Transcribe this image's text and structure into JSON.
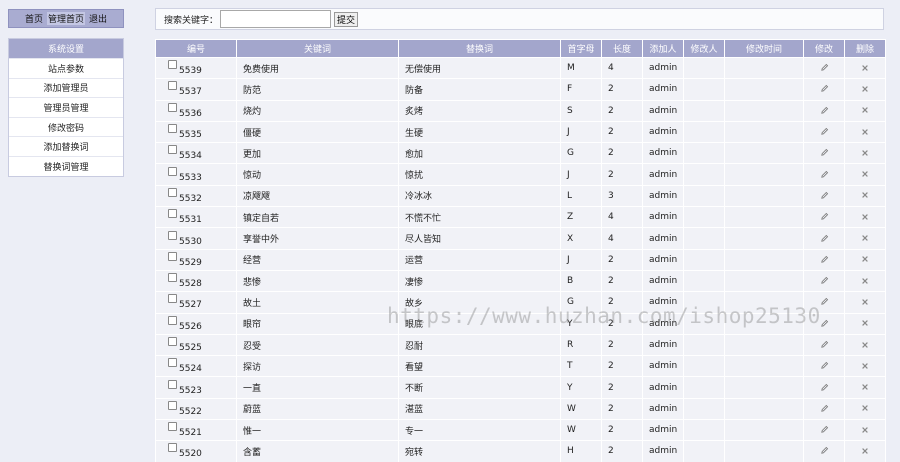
{
  "topnav": {
    "items": [
      "首页",
      "管理首页",
      "退出"
    ]
  },
  "sidemenu": {
    "title": "系统设置",
    "items": [
      "站点参数",
      "添加管理员",
      "管理员管理",
      "修改密码",
      "添加替换词",
      "替换词管理"
    ]
  },
  "search": {
    "label": "搜索关键字：",
    "value": "",
    "placeholder": "",
    "button": "提交"
  },
  "table": {
    "headers": [
      "编号",
      "关键词",
      "替换词",
      "首字母",
      "长度",
      "添加人",
      "修改人",
      "修改时间",
      "修改",
      "删除"
    ],
    "rows": [
      {
        "id": "5539",
        "keyword": "免费使用",
        "replace": "无偿使用",
        "initial": "M",
        "length": "4",
        "adder": "admin",
        "modifier": "",
        "modtime": ""
      },
      {
        "id": "5537",
        "keyword": "防范",
        "replace": "防备",
        "initial": "F",
        "length": "2",
        "adder": "admin",
        "modifier": "",
        "modtime": ""
      },
      {
        "id": "5536",
        "keyword": "烧灼",
        "replace": "炙烤",
        "initial": "S",
        "length": "2",
        "adder": "admin",
        "modifier": "",
        "modtime": ""
      },
      {
        "id": "5535",
        "keyword": "僵硬",
        "replace": "生硬",
        "initial": "J",
        "length": "2",
        "adder": "admin",
        "modifier": "",
        "modtime": ""
      },
      {
        "id": "5534",
        "keyword": "更加",
        "replace": "愈加",
        "initial": "G",
        "length": "2",
        "adder": "admin",
        "modifier": "",
        "modtime": ""
      },
      {
        "id": "5533",
        "keyword": "惊动",
        "replace": "惊扰",
        "initial": "J",
        "length": "2",
        "adder": "admin",
        "modifier": "",
        "modtime": ""
      },
      {
        "id": "5532",
        "keyword": "凉飕飕",
        "replace": "冷冰冰",
        "initial": "L",
        "length": "3",
        "adder": "admin",
        "modifier": "",
        "modtime": ""
      },
      {
        "id": "5531",
        "keyword": "镇定自若",
        "replace": "不慌不忙",
        "initial": "Z",
        "length": "4",
        "adder": "admin",
        "modifier": "",
        "modtime": ""
      },
      {
        "id": "5530",
        "keyword": "享誉中外",
        "replace": "尽人皆知",
        "initial": "X",
        "length": "4",
        "adder": "admin",
        "modifier": "",
        "modtime": ""
      },
      {
        "id": "5529",
        "keyword": "经营",
        "replace": "运营",
        "initial": "J",
        "length": "2",
        "adder": "admin",
        "modifier": "",
        "modtime": ""
      },
      {
        "id": "5528",
        "keyword": "悲惨",
        "replace": "凄惨",
        "initial": "B",
        "length": "2",
        "adder": "admin",
        "modifier": "",
        "modtime": ""
      },
      {
        "id": "5527",
        "keyword": "故土",
        "replace": "故乡",
        "initial": "G",
        "length": "2",
        "adder": "admin",
        "modifier": "",
        "modtime": ""
      },
      {
        "id": "5526",
        "keyword": "眼帘",
        "replace": "眼底",
        "initial": "Y",
        "length": "2",
        "adder": "admin",
        "modifier": "",
        "modtime": ""
      },
      {
        "id": "5525",
        "keyword": "忍受",
        "replace": "忍耐",
        "initial": "R",
        "length": "2",
        "adder": "admin",
        "modifier": "",
        "modtime": ""
      },
      {
        "id": "5524",
        "keyword": "探访",
        "replace": "看望",
        "initial": "T",
        "length": "2",
        "adder": "admin",
        "modifier": "",
        "modtime": ""
      },
      {
        "id": "5523",
        "keyword": "一直",
        "replace": "不断",
        "initial": "Y",
        "length": "2",
        "adder": "admin",
        "modifier": "",
        "modtime": ""
      },
      {
        "id": "5522",
        "keyword": "蔚蓝",
        "replace": "湛蓝",
        "initial": "W",
        "length": "2",
        "adder": "admin",
        "modifier": "",
        "modtime": ""
      },
      {
        "id": "5521",
        "keyword": "惟一",
        "replace": "专一",
        "initial": "W",
        "length": "2",
        "adder": "admin",
        "modifier": "",
        "modtime": ""
      },
      {
        "id": "5520",
        "keyword": "含蓄",
        "replace": "宛转",
        "initial": "H",
        "length": "2",
        "adder": "admin",
        "modifier": "",
        "modtime": ""
      }
    ]
  },
  "watermark": "https://www.huzhan.com/ishop25130",
  "colors": {
    "header_bg": "#a3a6cc",
    "page_bg": "#eceef6",
    "cell_bg": "#f1f2f7"
  }
}
